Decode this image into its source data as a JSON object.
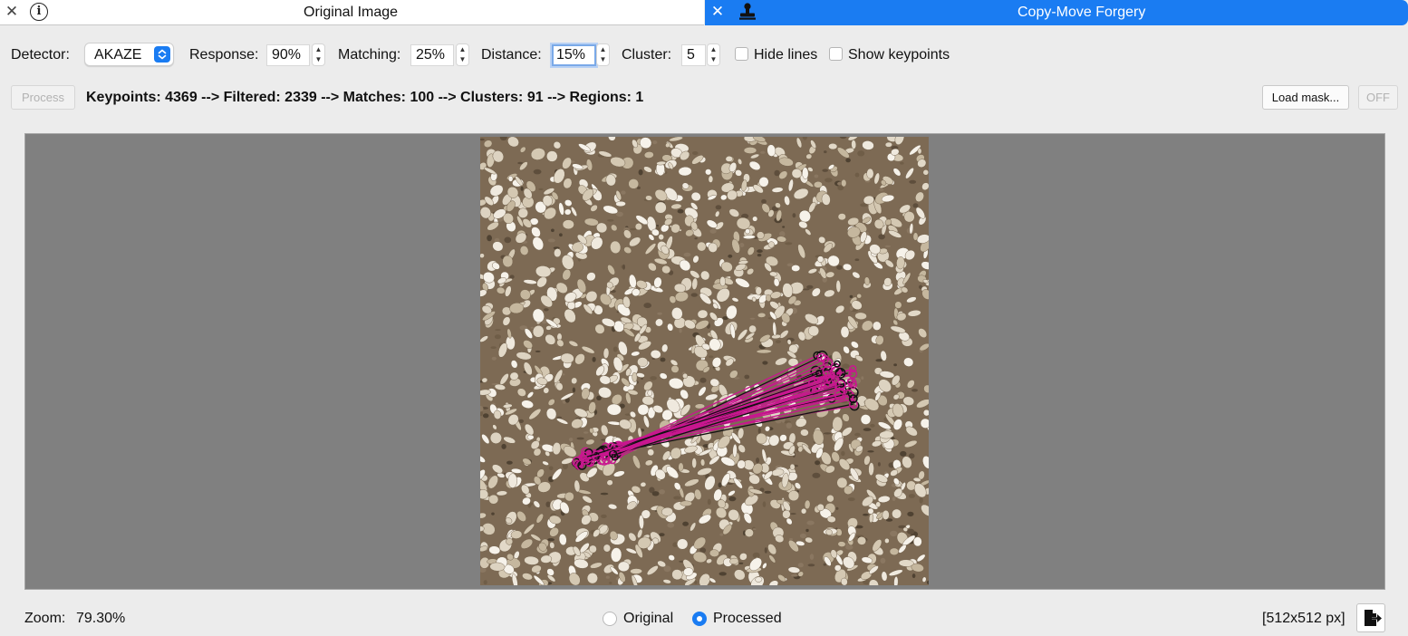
{
  "tabs": [
    {
      "title": "Original Image",
      "close_icon": "close-icon",
      "extra_icon": "info-icon",
      "active": false
    },
    {
      "title": "Copy-Move Forgery",
      "close_icon": "close-icon",
      "extra_icon": "stamp-icon",
      "active": true
    }
  ],
  "controls": {
    "detector_label": "Detector:",
    "detector_value": "AKAZE",
    "response_label": "Response:",
    "response_value": "90%",
    "matching_label": "Matching:",
    "matching_value": "25%",
    "distance_label": "Distance:",
    "distance_value": "15%",
    "cluster_label": "Cluster:",
    "cluster_value": "5",
    "hide_lines_label": "Hide lines",
    "hide_lines_checked": false,
    "show_keypoints_label": "Show keypoints",
    "show_keypoints_checked": false
  },
  "actions": {
    "process_label": "Process",
    "stats": "Keypoints: 4369 --> Filtered: 2339 --> Matches: 100 --> Clusters: 91 --> Regions: 1",
    "load_mask_label": "Load mask...",
    "off_label": "OFF"
  },
  "status": {
    "zoom_label": "Zoom:",
    "zoom_value": "79.30%",
    "radio_original_label": "Original",
    "radio_processed_label": "Processed",
    "selected_view": "Processed",
    "image_size": "[512x512 px]"
  },
  "colors": {
    "accent": "#1a7cf2",
    "viewer_background": "#808080",
    "match_lines": "#c8178f"
  },
  "icons": {
    "export": "export-icon",
    "select_arrows": "updown-chevron-icon",
    "stepper": "stepper-arrows-icon"
  }
}
